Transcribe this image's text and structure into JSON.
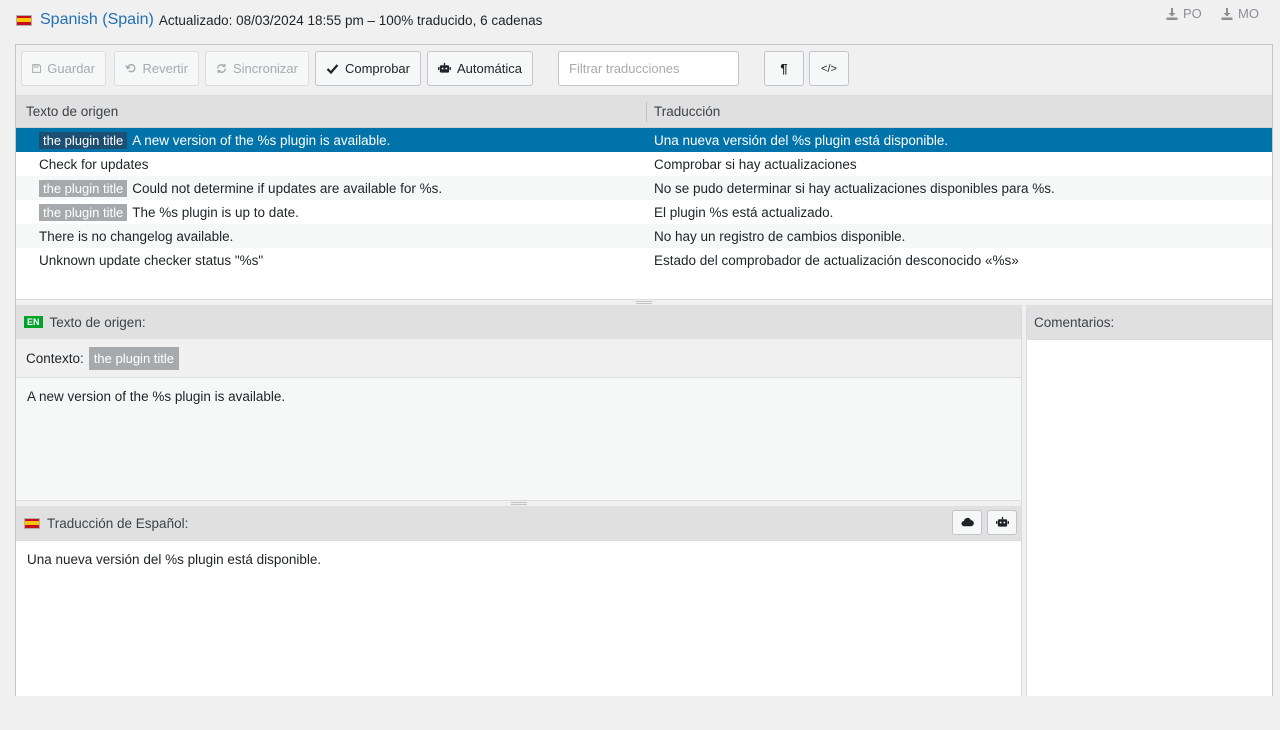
{
  "header": {
    "language": "Spanish (Spain)",
    "meta": "Actualizado: 08/03/2024 18:55 pm – 100% traducido, 6 cadenas",
    "download_po": "PO",
    "download_mo": "MO"
  },
  "toolbar": {
    "save": "Guardar",
    "revert": "Revertir",
    "sync": "Sincronizar",
    "check": "Comprobar",
    "auto": "Automática",
    "filter_placeholder": "Filtrar traducciones",
    "pilcrow": "¶",
    "code": "</>"
  },
  "table": {
    "col_source": "Texto de origen",
    "col_translation": "Traducción",
    "rows": [
      {
        "context": "the plugin title",
        "source": "A new version of the %s plugin is available.",
        "translation": "Una nueva versión del %s plugin está disponible."
      },
      {
        "context": "",
        "source": "Check for updates",
        "translation": "Comprobar si hay actualizaciones"
      },
      {
        "context": "the plugin title",
        "source": "Could not determine if updates are available for %s.",
        "translation": "No se pudo determinar si hay actualizaciones disponibles para %s."
      },
      {
        "context": "the plugin title",
        "source": "The %s plugin is up to date.",
        "translation": "El plugin %s está actualizado."
      },
      {
        "context": "",
        "source": "There is no changelog available.",
        "translation": "No hay un registro de cambios disponible."
      },
      {
        "context": "",
        "source": "Unknown update checker status \"%s\"",
        "translation": "Estado del comprobador de actualización desconocido «%s»"
      }
    ]
  },
  "source_editor": {
    "badge": "EN",
    "title": "Texto de origen:",
    "context_label": "Contexto:",
    "context_value": "the plugin title",
    "text": "A new version of the %s plugin is available."
  },
  "translation_editor": {
    "title": "Traducción de Español:",
    "text": "Una nueva versión del %s plugin está disponible."
  },
  "comments": {
    "title": "Comentarios:"
  },
  "icons": {
    "download": "download-icon",
    "save": "floppy-icon",
    "revert": "undo-icon",
    "sync": "refresh-icon",
    "check": "checkmark-icon",
    "auto": "robot-icon",
    "cloud": "cloud-icon"
  },
  "colors": {
    "selected_row": "#0073aa",
    "link": "#2271b1",
    "en_badge": "#00a32a"
  }
}
